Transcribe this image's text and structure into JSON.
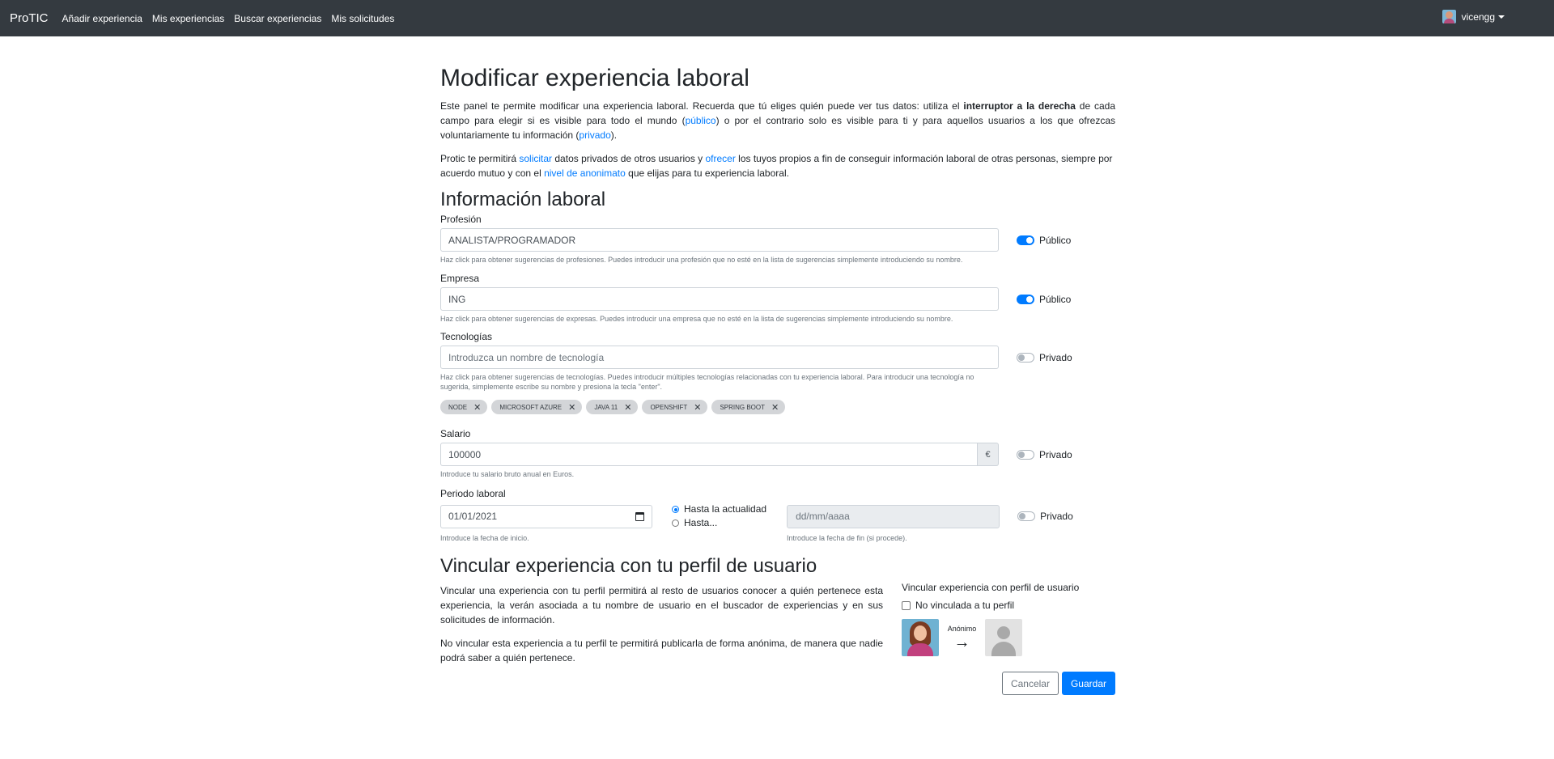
{
  "navbar": {
    "brand": "ProTIC",
    "links": [
      "Añadir experiencia",
      "Mis experiencias",
      "Buscar experiencias",
      "Mis solicitudes"
    ],
    "user": "vicengg"
  },
  "page": {
    "title": "Modificar experiencia laboral",
    "intro1": {
      "a": "Este panel te permite modificar una experiencia laboral. Recuerda que tú eliges quién puede ver tus datos: utiliza el ",
      "bold": "interruptor a la derecha",
      "b": " de cada campo para elegir si es visible para todo el mundo (",
      "link1": "público",
      "c": ") o por el contrario solo es visible para ti y para aquellos usuarios a los que ofrezcas voluntariamente tu información (",
      "link2": "privado",
      "d": ")."
    },
    "intro2": {
      "a": "Protic te permitirá ",
      "link1": "solicitar",
      "b": " datos privados de otros usuarios y ",
      "link2": "ofrecer",
      "c": " los tuyos propios a fin de conseguir información laboral de otras personas, siempre por acuerdo mutuo y con el ",
      "link3": "nivel de anonimato",
      "d": " que elijas para tu experiencia laboral."
    }
  },
  "info": {
    "heading": "Información laboral",
    "profesion": {
      "label": "Profesión",
      "value": "ANALISTA/PROGRAMADOR",
      "help": "Haz click para obtener sugerencias de profesiones. Puedes introducir una profesión que no esté en la lista de sugerencias simplemente introduciendo su nombre.",
      "visibility": "Público"
    },
    "empresa": {
      "label": "Empresa",
      "value": "ING",
      "help": "Haz click para obtener sugerencias de expresas. Puedes introducir una empresa que no esté en la lista de sugerencias simplemente introduciendo su nombre.",
      "visibility": "Público"
    },
    "tecnologias": {
      "label": "Tecnologías",
      "placeholder": "Introduzca un nombre de tecnología",
      "help": "Haz click para obtener sugerencias de tecnologías. Puedes introducir múltiples tecnologías relacionadas con tu experiencia laboral. Para introducir una tecnología no sugerida, simplemente escribe su nombre y presiona la tecla \"enter\".",
      "visibility": "Privado",
      "tags": [
        "NODE",
        "MICROSOFT AZURE",
        "JAVA 11",
        "OPENSHIFT",
        "SPRING BOOT"
      ],
      "tag_close": "✕"
    },
    "salario": {
      "label": "Salario",
      "value": "100000",
      "currency": "€",
      "help": "Introduce tu salario bruto anual en Euros.",
      "visibility": "Privado"
    },
    "periodo": {
      "label": "Periodo laboral",
      "start": "01/01/2021",
      "start_help": "Introduce la fecha de inicio.",
      "option_current": "Hasta la actualidad",
      "option_until": "Hasta...",
      "end_placeholder": "dd/mm/aaaa",
      "end_help": "Introduce la fecha de fin (si procede).",
      "visibility": "Privado"
    }
  },
  "vincular": {
    "heading": "Vincular experiencia con tu perfil de usuario",
    "p1": "Vincular una experiencia con tu perfil permitirá al resto de usuarios conocer a quién pertenece esta experiencia, la verán asociada a tu nombre de usuario en el buscador de experiencias y en sus solicitudes de información.",
    "p2": "No vincular esta experiencia a tu perfil te permitirá publicarla de forma anónima, de manera que nadie podrá saber a quién pertenece.",
    "side_title": "Vincular experiencia con perfil de usuario",
    "checkbox_label": "No vinculada a tu perfil",
    "anon_label": "Anónimo",
    "arrow": "→"
  },
  "actions": {
    "cancel": "Cancelar",
    "save": "Guardar"
  },
  "colors": {
    "navbar": "#343a40",
    "primary": "#007bff"
  }
}
